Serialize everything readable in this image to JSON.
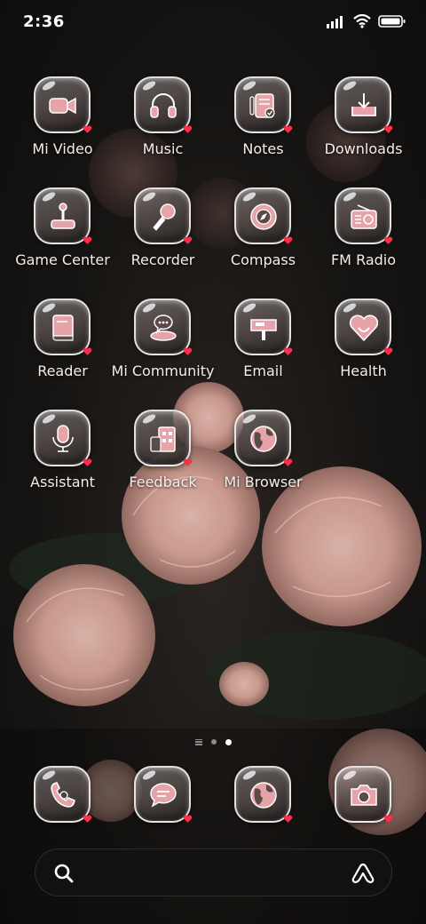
{
  "status_bar": {
    "time": "2:36"
  },
  "apps": [
    {
      "label": "Mi Video",
      "icon": "video-camera-icon"
    },
    {
      "label": "Music",
      "icon": "headphones-icon"
    },
    {
      "label": "Notes",
      "icon": "notes-icon"
    },
    {
      "label": "Downloads",
      "icon": "download-icon"
    },
    {
      "label": "Game Center",
      "icon": "joystick-icon"
    },
    {
      "label": "Recorder",
      "icon": "microphone-handheld-icon"
    },
    {
      "label": "Compass",
      "icon": "compass-icon"
    },
    {
      "label": "FM Radio",
      "icon": "radio-icon"
    },
    {
      "label": "Reader",
      "icon": "book-icon"
    },
    {
      "label": "Mi Community",
      "icon": "chat-bubble-icon"
    },
    {
      "label": "Email",
      "icon": "mailbox-icon"
    },
    {
      "label": "Health",
      "icon": "heart-icon"
    },
    {
      "label": "Assistant",
      "icon": "microphone-icon"
    },
    {
      "label": "Feedback",
      "icon": "building-icon"
    },
    {
      "label": "Mi Browser",
      "icon": "globe-icon"
    }
  ],
  "dock": [
    {
      "name": "Phone",
      "icon": "phone-icon"
    },
    {
      "name": "Messages",
      "icon": "message-icon"
    },
    {
      "name": "Browser",
      "icon": "globe-icon"
    },
    {
      "name": "Camera",
      "icon": "camera-icon"
    }
  ],
  "page_indicator": {
    "pages": 2,
    "current": 2
  },
  "colors": {
    "accent": "#e7a4a8",
    "label": "#f4eeea",
    "heart": "#ff2d4a"
  }
}
